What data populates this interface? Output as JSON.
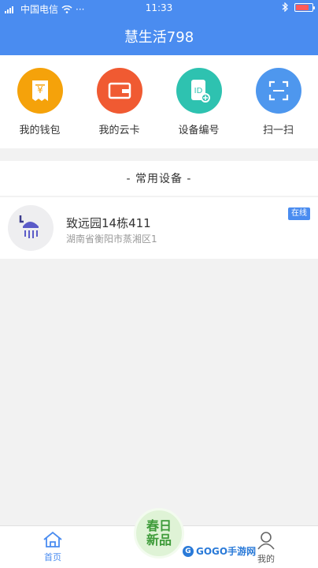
{
  "status_bar": {
    "carrier": "中国电信",
    "time": "11:33"
  },
  "header": {
    "title": "慧生活798"
  },
  "quick_actions": [
    {
      "label": "我的钱包",
      "icon": "wallet-icon",
      "color": "#f5a20a"
    },
    {
      "label": "我的云卡",
      "icon": "card-icon",
      "color": "#f05a32"
    },
    {
      "label": "设备编号",
      "icon": "device-id-icon",
      "color": "#2ec2b0"
    },
    {
      "label": "扫一扫",
      "icon": "scan-icon",
      "color": "#4e97ee"
    }
  ],
  "section": {
    "title": "- 常用设备 -"
  },
  "device": {
    "name": "致远园14栋411",
    "address": "湖南省衡阳市蒸湘区1",
    "status": "在线",
    "icon": "shower-icon"
  },
  "nav": {
    "home_label": "首页",
    "me_label": "我的"
  },
  "promo": {
    "line1": "春日",
    "line2": "新品"
  },
  "watermark": {
    "text": "GOGO手游网"
  },
  "colors": {
    "primary": "#4a8cf0",
    "background": "#f2f2f2"
  }
}
